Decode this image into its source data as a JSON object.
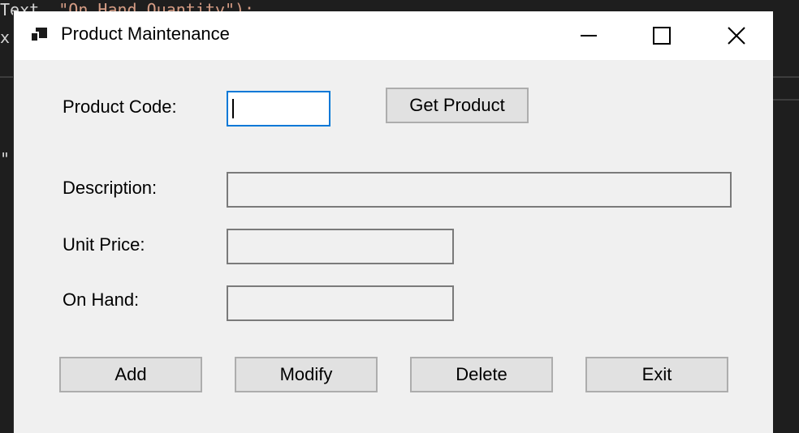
{
  "background_code": {
    "line1_prefix": "Text",
    "line1_string": "\"On Hand Quantity\");",
    "line2": "x",
    "line3": "\""
  },
  "window": {
    "title": "Product Maintenance",
    "controls": {
      "minimize_icon": "minimize-icon",
      "maximize_icon": "maximize-icon",
      "close_icon": "close-icon"
    }
  },
  "form": {
    "product_code_label": "Product Code:",
    "product_code_value": "",
    "get_product_label": "Get Product",
    "description_label": "Description:",
    "description_value": "",
    "unit_price_label": "Unit Price:",
    "unit_price_value": "",
    "on_hand_label": "On Hand:",
    "on_hand_value": ""
  },
  "actions": {
    "add_label": "Add",
    "modify_label": "Modify",
    "delete_label": "Delete",
    "exit_label": "Exit"
  }
}
